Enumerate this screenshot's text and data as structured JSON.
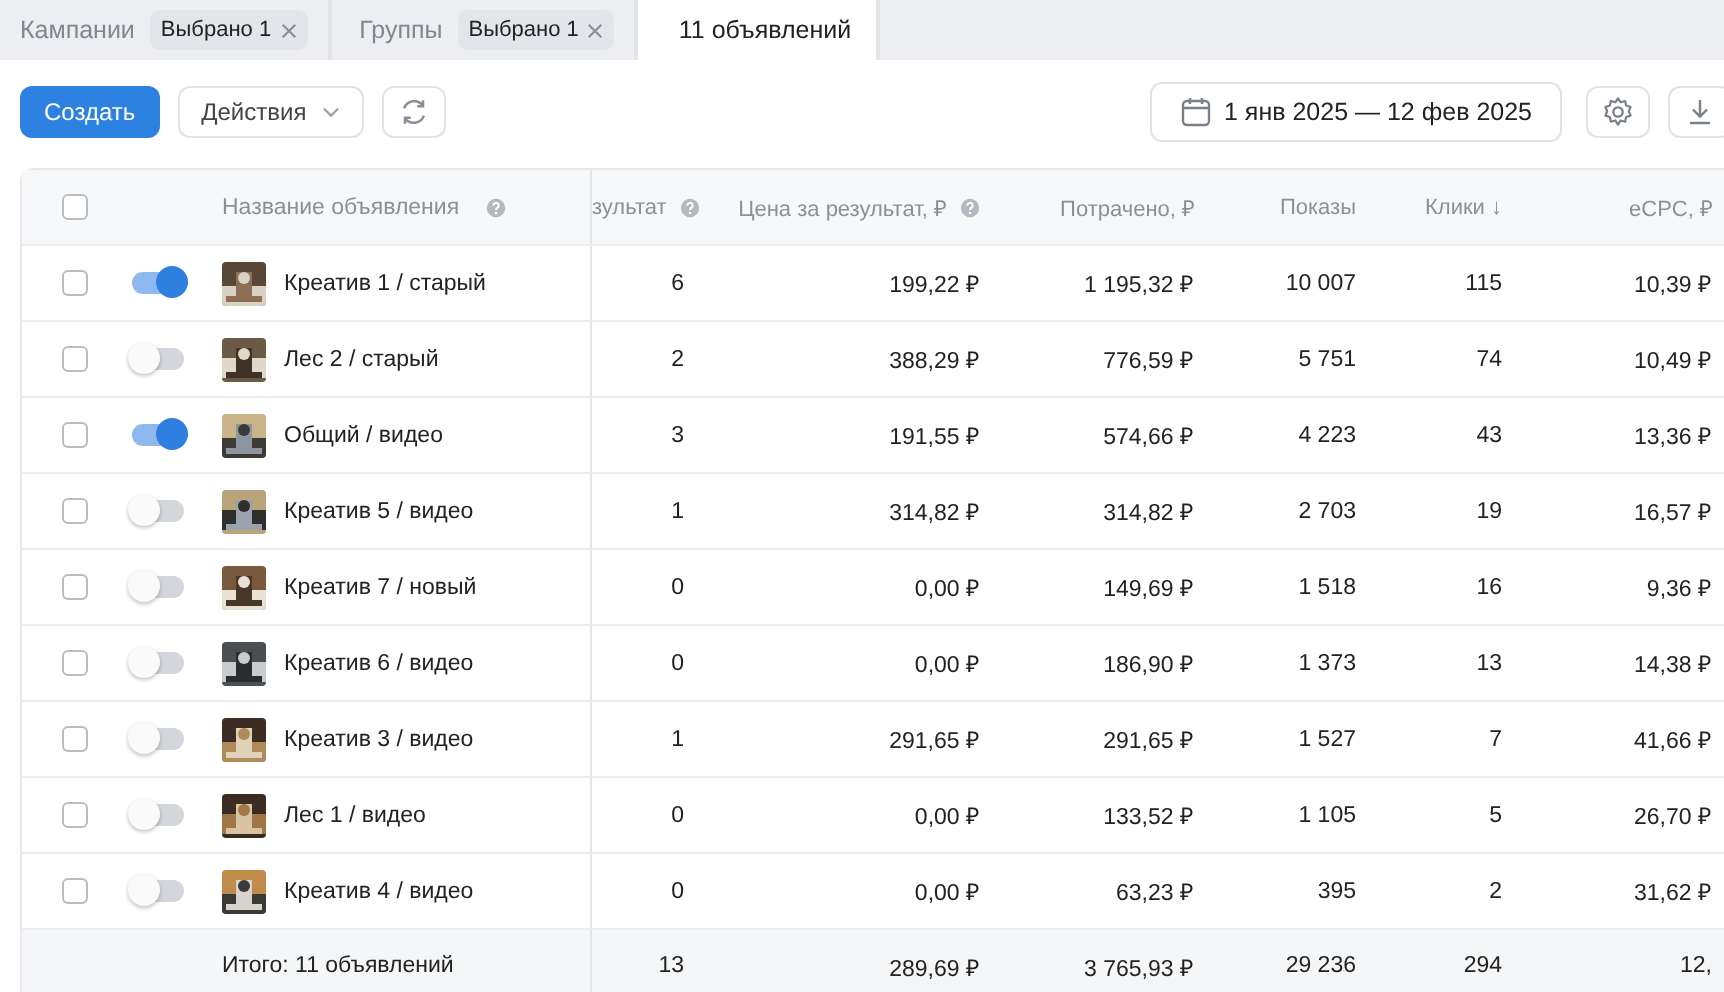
{
  "tabs": [
    {
      "label": "Кампании",
      "chip": "Выбрано 1",
      "selected": false
    },
    {
      "label": "Группы",
      "chip": "Выбрано 1",
      "selected": false
    },
    {
      "label": "11 объявлений",
      "selected": true
    }
  ],
  "toolbar": {
    "create_button": "Создать",
    "actions_button": "Действия",
    "date_range": "1 янв 2025 — 12 фев 2025"
  },
  "table": {
    "select_all_checked": false,
    "name_column": {
      "label": "Название объявления",
      "help": true
    },
    "columns": [
      {
        "label": "зультат",
        "help": true
      },
      {
        "label": "Цена за результат, ₽",
        "help": true
      },
      {
        "label": "Потрачено, ₽",
        "help": false
      },
      {
        "label": "Показы",
        "help": false
      },
      {
        "label": "Клики ↓",
        "help": false
      },
      {
        "label": "eCPC, ₽",
        "help": false
      }
    ],
    "rows": [
      {
        "checked": false,
        "on": true,
        "name": "Креатив 1 / старый",
        "cells": [
          "6",
          "199,22 ₽",
          "1 195,32 ₽",
          "10 007",
          "115",
          "10,39 ₽"
        ]
      },
      {
        "checked": false,
        "on": false,
        "name": "Лес 2 / старый",
        "cells": [
          "2",
          "388,29 ₽",
          "776,59 ₽",
          "5 751",
          "74",
          "10,49 ₽"
        ]
      },
      {
        "checked": false,
        "on": true,
        "name": "Общий / видео",
        "cells": [
          "3",
          "191,55 ₽",
          "574,66 ₽",
          "4 223",
          "43",
          "13,36 ₽"
        ]
      },
      {
        "checked": false,
        "on": false,
        "name": "Креатив 5 / видео",
        "cells": [
          "1",
          "314,82 ₽",
          "314,82 ₽",
          "2 703",
          "19",
          "16,57 ₽"
        ]
      },
      {
        "checked": false,
        "on": false,
        "name": "Креатив 7 / новый",
        "cells": [
          "0",
          "0,00 ₽",
          "149,69 ₽",
          "1 518",
          "16",
          "9,36 ₽"
        ]
      },
      {
        "checked": false,
        "on": false,
        "name": "Креатив 6 / видео",
        "cells": [
          "0",
          "0,00 ₽",
          "186,90 ₽",
          "1 373",
          "13",
          "14,38 ₽"
        ]
      },
      {
        "checked": false,
        "on": false,
        "name": "Креатив 3 / видео",
        "cells": [
          "1",
          "291,65 ₽",
          "291,65 ₽",
          "1 527",
          "7",
          "41,66 ₽"
        ]
      },
      {
        "checked": false,
        "on": false,
        "name": "Лес 1 / видео",
        "cells": [
          "0",
          "0,00 ₽",
          "133,52 ₽",
          "1 105",
          "5",
          "26,70 ₽"
        ]
      },
      {
        "checked": false,
        "on": false,
        "name": "Креатив 4 / видео",
        "cells": [
          "0",
          "0,00 ₽",
          "63,23 ₽",
          "395",
          "2",
          "31,62 ₽"
        ]
      }
    ],
    "totals": {
      "label": "Итого: 11 объявлений",
      "cells": [
        "13",
        "289,69 ₽",
        "3 765,93 ₽",
        "29 236",
        "294",
        "12,"
      ]
    }
  }
}
